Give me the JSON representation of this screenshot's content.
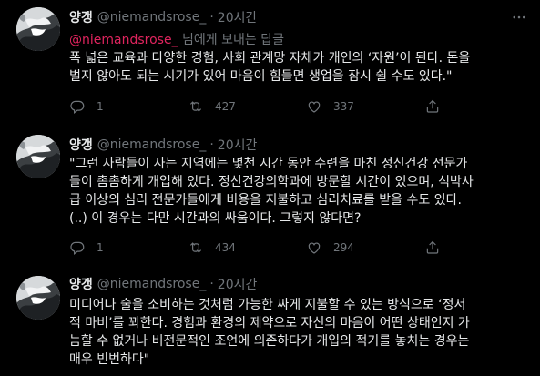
{
  "tweets": [
    {
      "name": "양갱",
      "handle": "@niemandsrose_",
      "separator": "·",
      "time": "20시간",
      "reply_mention": "@niemandsrose_",
      "reply_suffix": " 님에게 보내는 답글",
      "lines": [
        "폭 넓은 교육과 다양한 경험, 사회 관계망 자체가 개인의 ‘자원’이 된다. 돈을",
        "벌지 않아도 되는 시기가 있어 마음이 힘들면 생업을 잠시 쉴 수도 있다.\""
      ],
      "replies": "1",
      "retweets": "427",
      "likes": "337"
    },
    {
      "name": "양갱",
      "handle": "@niemandsrose_",
      "separator": "·",
      "time": "20시간",
      "lines": [
        "\"그런 사람들이 사는 지역에는 몇천 시간 동안 수련을 마친 정신건강 전문가",
        "들이 촘촘하게 개업해 있다. 정신건강의학과에 방문할 시간이 있으며, 석박사",
        "급 이상의 심리 전문가들에게 비용을 지불하고 심리치료를 받을 수도 있다.",
        "(..) 이 경우는 다만 시간과의 싸움이다. 그렇지 않다면?"
      ],
      "replies": "1",
      "retweets": "434",
      "likes": "294"
    },
    {
      "name": "양갱",
      "handle": "@niemandsrose_",
      "separator": "·",
      "time": "20시간",
      "lines": [
        "미디어나 술을 소비하는 것처럼 가능한 싸게 지불할 수 있는 방식으로 ‘정서",
        "적 마비’를 꾀한다. 경험과 환경의 제약으로 자신의 마음이 어떤 상태인지 가",
        "늠할 수 없거나 비전문적인 조언에 의존하다가 개입의 적기를 놓치는 경우는",
        "매우 빈번하다\""
      ]
    }
  ],
  "icons": {
    "more": "more-icon",
    "reply": "reply-icon",
    "retweet": "retweet-icon",
    "like": "heart-icon",
    "share": "share-icon"
  }
}
